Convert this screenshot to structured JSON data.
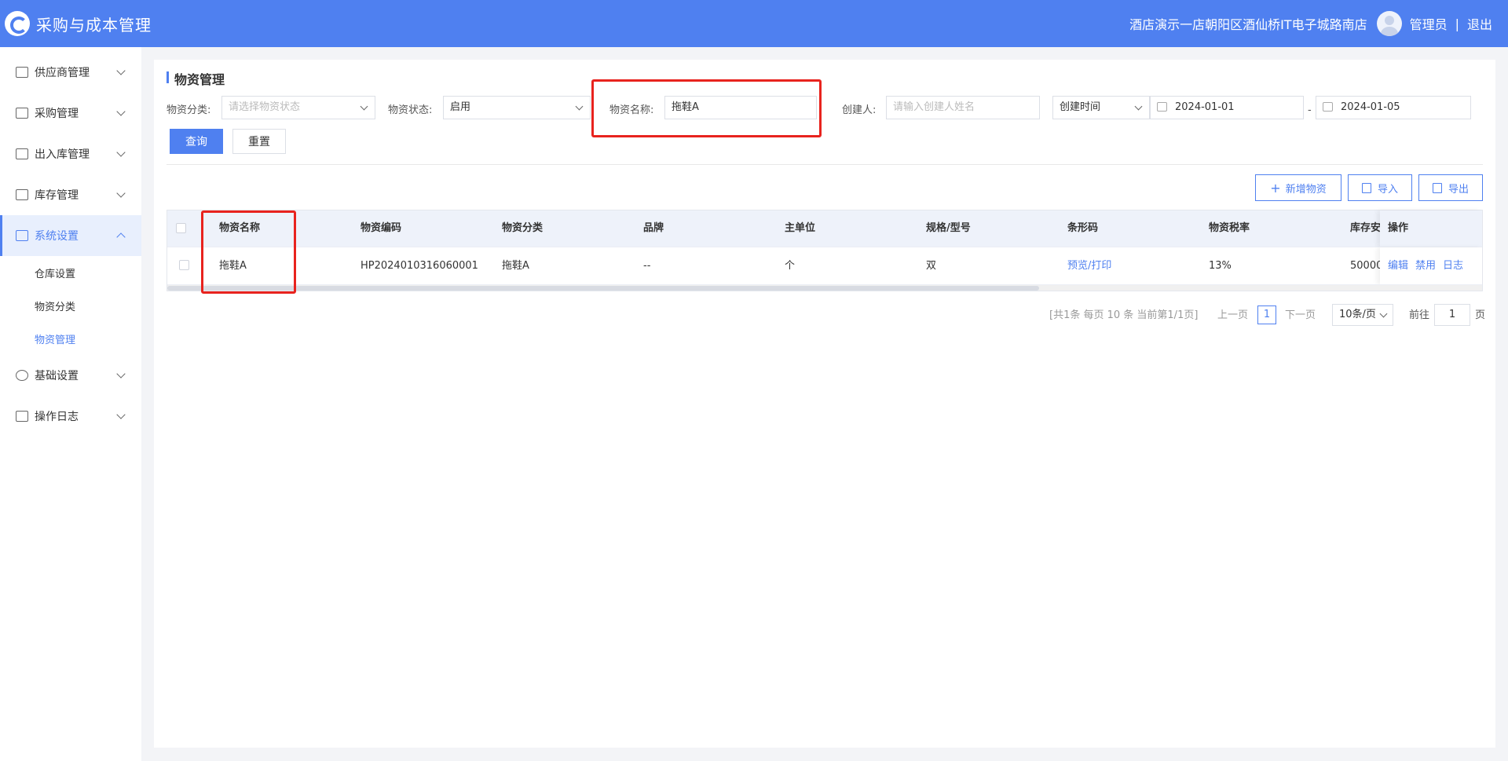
{
  "header": {
    "app_title": "采购与成本管理",
    "store_name": "酒店演示一店朝阳区酒仙桥IT电子城路南店",
    "user_name": "管理员",
    "separator": "|",
    "logout": "退出"
  },
  "sidebar": {
    "items": [
      {
        "label": "供应商管理",
        "icon": "supplier-icon"
      },
      {
        "label": "采购管理",
        "icon": "purchase-icon"
      },
      {
        "label": "出入库管理",
        "icon": "inout-icon"
      },
      {
        "label": "库存管理",
        "icon": "inventory-icon"
      },
      {
        "label": "系统设置",
        "icon": "settings-icon",
        "expanded": true
      },
      {
        "label": "基础设置",
        "icon": "gear-icon"
      },
      {
        "label": "操作日志",
        "icon": "log-icon"
      }
    ],
    "sub_items": [
      "仓库设置",
      "物资分类",
      "物资管理"
    ],
    "current_sub": "物资管理"
  },
  "page": {
    "title": "物资管理"
  },
  "filters": {
    "category_label": "物资分类:",
    "category_placeholder": "请选择物资状态",
    "status_label": "物资状态:",
    "status_value": "启用",
    "name_label": "物资名称:",
    "name_value": "拖鞋A",
    "creator_label": "创建人:",
    "creator_placeholder": "请输入创建人姓名",
    "time_type": "创建时间",
    "date_start": "2024-01-01",
    "date_sep": "-",
    "date_end": "2024-01-05",
    "query_button": "查询",
    "reset_button": "重置"
  },
  "actions": {
    "add_button": "新增物资",
    "import_button": "导入",
    "export_button": "导出"
  },
  "table": {
    "headers": [
      "物资名称",
      "物资编码",
      "物资分类",
      "品牌",
      "主单位",
      "规格/型号",
      "条形码",
      "物资税率",
      "库存安",
      "操作"
    ],
    "rows": [
      {
        "name": "拖鞋A",
        "code": "HP2024010316060001",
        "category": "拖鞋A",
        "brand": "--",
        "unit": "个",
        "spec": "双",
        "barcode": "预览/打印",
        "tax": "13%",
        "stock": "50000",
        "op_edit": "编辑",
        "op_disable": "禁用",
        "op_log": "日志"
      }
    ]
  },
  "pagination": {
    "summary": "[共1条 每页 10 条 当前第1/1页]",
    "prev": "上一页",
    "current_page": "1",
    "next": "下一页",
    "page_size": "10条/页",
    "goto_label": "前往",
    "goto_value": "1",
    "page_suffix": "页"
  },
  "colors": {
    "primary": "#4f80f0",
    "highlight": "#e8231e"
  }
}
